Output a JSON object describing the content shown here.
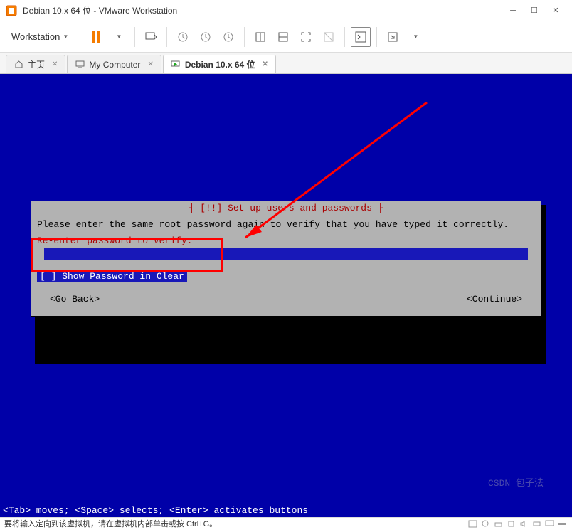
{
  "window": {
    "title": "Debian 10.x 64 位 - VMware Workstation"
  },
  "toolbar": {
    "menu_label": "Workstation"
  },
  "tabs": [
    {
      "label": "主页",
      "active": false
    },
    {
      "label": "My Computer",
      "active": false
    },
    {
      "label": "Debian 10.x 64 位",
      "active": true
    }
  ],
  "installer": {
    "header": "┤ [!!] Set up users and passwords ├",
    "prompt": "Please enter the same root password again to verify that you have typed it correctly.",
    "field_label": "Re-enter password to verify:",
    "checkbox_label": "[ ] Show Password in Clear",
    "back_button": "<Go Back>",
    "continue_button": "<Continue>"
  },
  "console_help": "<Tab> moves; <Space> selects; <Enter> activates buttons",
  "statusbar": {
    "hint": "要将输入定向到该虚拟机，请在虚拟机内部单击或按 Ctrl+G。"
  },
  "watermark": "CSDN 包子法"
}
